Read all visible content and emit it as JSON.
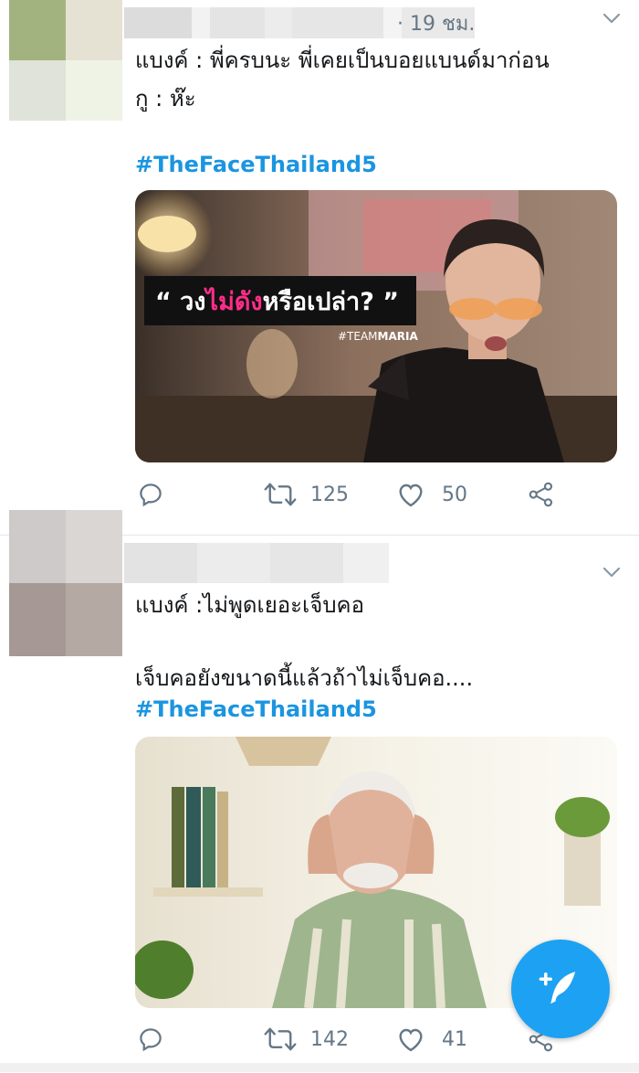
{
  "tweets": [
    {
      "time": "· 19 ชม.",
      "line1": "แบงค์ : พี่ครบนะ พี่เคยเป็นบอยแบนด์มาก่อน",
      "line2": "กู : ห๊ะ",
      "hashtag": "#TheFaceThailand5",
      "media": {
        "caption_open": "“ วง",
        "caption_pink": "ไม่ดัง",
        "caption_close": "หรือเปล่า? ”",
        "tag_prefix": "#TEAM",
        "tag_bold": "MARIA"
      },
      "stats": {
        "retweets": "125",
        "likes": "50"
      }
    },
    {
      "line1": "แบงค์ :ไม่พูดเยอะเจ็บคอ",
      "line2": "เจ็บคอยังขนาดนี้แล้วถ้าไม่เจ็บคอ....",
      "hashtag": "#TheFaceThailand5",
      "stats": {
        "retweets": "142",
        "likes": "41"
      }
    }
  ],
  "colors": {
    "accent": "#1da1f2",
    "hashtag": "#1b95e0",
    "muted": "#657786",
    "caption_pink": "#ff2d8a"
  },
  "icons": [
    "reply-icon",
    "retweet-icon",
    "like-icon",
    "share-icon",
    "chevron-down-icon",
    "compose-tweet-icon"
  ]
}
